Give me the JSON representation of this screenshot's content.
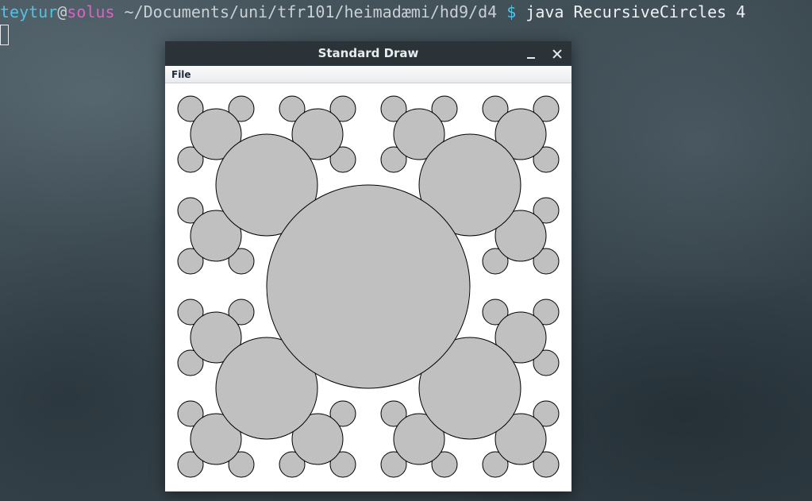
{
  "terminal": {
    "user": "teytur",
    "at": "@",
    "host": "solus",
    "path": " ~/Documents/uni/tfr101/heimadæmi/hd9/d4 ",
    "prompt": "$",
    "command": " java RecursiveCircles 4"
  },
  "window": {
    "title": "Standard Draw",
    "menu": {
      "file_label": "File"
    }
  },
  "drawing": {
    "recursion_depth": 4,
    "fill_color": "#c0c0c0",
    "stroke_color": "#000000",
    "background_color": "#ffffff"
  },
  "icons": {
    "minimize": "minimize-icon",
    "close": "close-icon"
  }
}
